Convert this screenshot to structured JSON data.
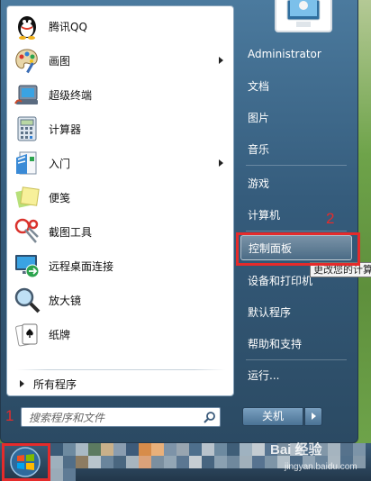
{
  "programs": [
    {
      "label": "腾讯QQ",
      "icon": "qq-penguin-icon"
    },
    {
      "label": "画图",
      "icon": "paint-palette-icon",
      "submenu": true
    },
    {
      "label": "超级终端",
      "icon": "hyperterminal-icon"
    },
    {
      "label": "计算器",
      "icon": "calculator-icon"
    },
    {
      "label": "入门",
      "icon": "getting-started-icon",
      "submenu": true
    },
    {
      "label": "便笺",
      "icon": "sticky-notes-icon"
    },
    {
      "label": "截图工具",
      "icon": "snipping-tool-icon"
    },
    {
      "label": "远程桌面连接",
      "icon": "remote-desktop-icon"
    },
    {
      "label": "放大镜",
      "icon": "magnifier-icon"
    },
    {
      "label": "纸牌",
      "icon": "solitaire-cards-icon"
    }
  ],
  "all_programs": "所有程序",
  "search": {
    "placeholder": "搜索程序和文件"
  },
  "right_items": [
    {
      "label": "Administrator"
    },
    {
      "label": "文档"
    },
    {
      "label": "图片"
    },
    {
      "label": "音乐"
    },
    {
      "label": "游戏"
    },
    {
      "label": "计算机"
    },
    {
      "label": "控制面板",
      "highlighted": true
    },
    {
      "label": "设备和打印机"
    },
    {
      "label": "默认程序"
    },
    {
      "label": "帮助和支持"
    },
    {
      "label": "运行..."
    }
  ],
  "tooltip": "更改您的计算",
  "shutdown": {
    "label": "关机"
  },
  "steps": {
    "one": "1",
    "two": "2"
  },
  "watermark": {
    "brand": "Bai 经验",
    "url": "jingyan.baidu.com"
  },
  "colors": {
    "highlight": "#e52b2b",
    "menu_blue": "#355c7c",
    "accent_green": "#6ea34a"
  }
}
